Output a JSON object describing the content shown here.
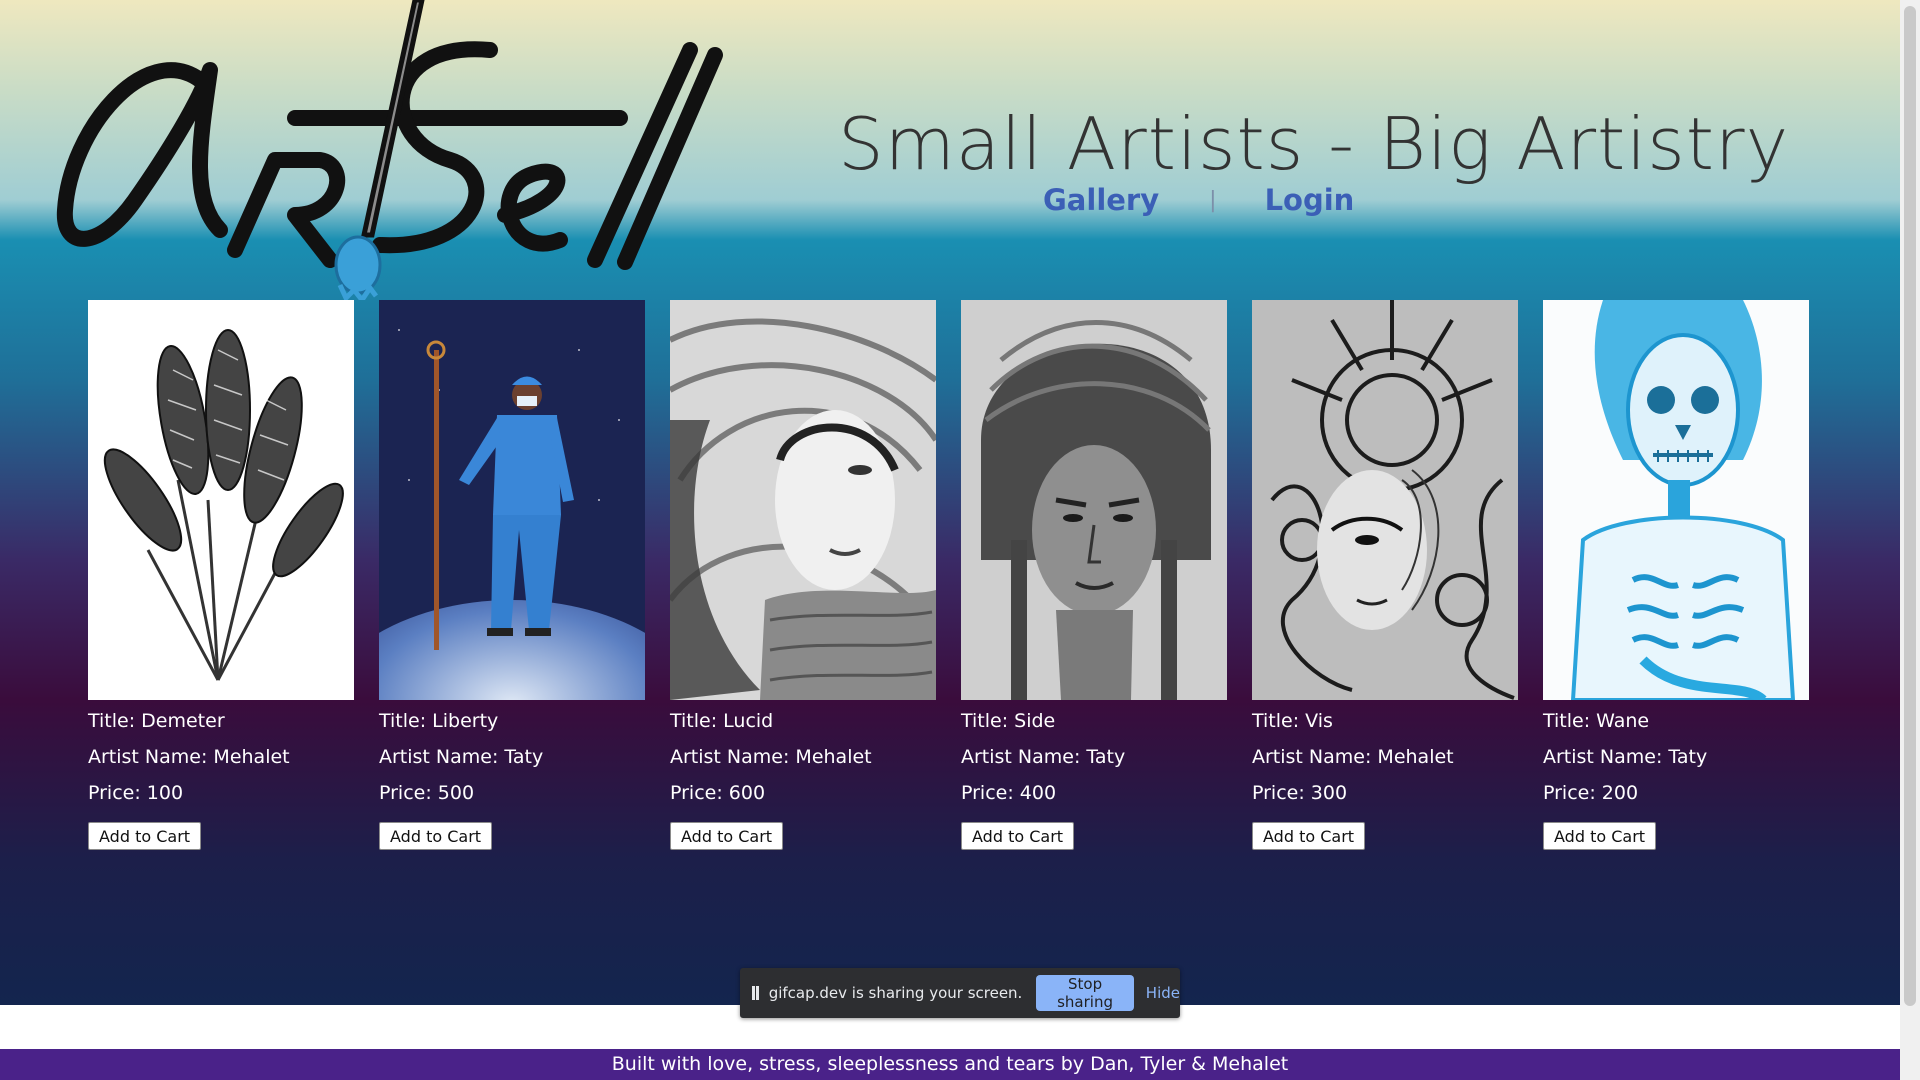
{
  "header": {
    "logo_text": "ArtSell",
    "tagline": "Small Artists - Big Artistry",
    "nav": {
      "gallery": "Gallery",
      "separator": "|",
      "login": "Login"
    }
  },
  "artworks": [
    {
      "title": "Title: Demeter",
      "artist": "Artist Name: Mehalet",
      "price": "Price: 100",
      "button": "Add to Cart",
      "image": "wheat-drawing"
    },
    {
      "title": "Title: Liberty",
      "artist": "Artist Name: Taty",
      "price": "Price: 500",
      "button": "Add to Cart",
      "image": "nurse-on-globe-painting"
    },
    {
      "title": "Title: Lucid",
      "artist": "Artist Name: Mehalet",
      "price": "Price: 600",
      "button": "Add to Cart",
      "image": "swirl-portrait-drawing"
    },
    {
      "title": "Title: Side",
      "artist": "Artist Name: Taty",
      "price": "Price: 400",
      "button": "Add to Cart",
      "image": "turban-portrait-drawing"
    },
    {
      "title": "Title: Vis",
      "artist": "Artist Name: Mehalet",
      "price": "Price: 300",
      "button": "Add to Cart",
      "image": "ornate-face-drawing"
    },
    {
      "title": "Title: Wane",
      "artist": "Artist Name: Taty",
      "price": "Price: 200",
      "button": "Add to Cart",
      "image": "blue-skeleton-painting"
    }
  ],
  "share_bar": {
    "text": "gifcap.dev is sharing your screen.",
    "stop_label": "Stop sharing",
    "hide_label": "Hide"
  },
  "footer": {
    "text": "Built with love, stress, sleeplessness and tears by Dan, Tyler & Mehalet"
  },
  "colors": {
    "nav_link": "#3b5fb6",
    "footer_bg": "#4a2289",
    "stop_button": "#8ab4f8"
  }
}
